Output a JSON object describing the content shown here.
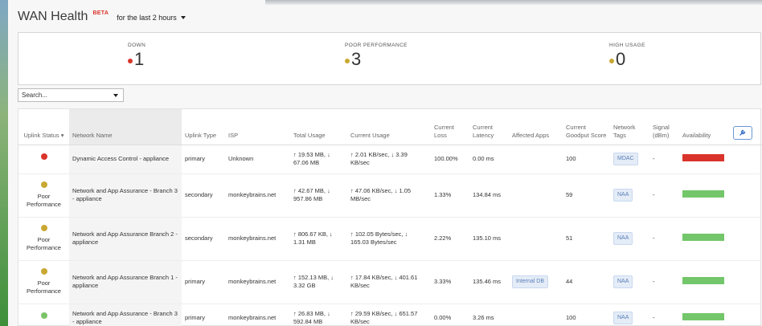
{
  "header": {
    "title": "WAN Health",
    "beta": "BETA",
    "timerange": "for the last 2 hours"
  },
  "summary": {
    "down": {
      "label": "DOWN",
      "value": "1",
      "color": "#d9342b"
    },
    "poor": {
      "label": "POOR PERFORMANCE",
      "value": "3",
      "color": "#c9a833"
    },
    "high": {
      "label": "HIGH USAGE",
      "value": "0",
      "color": "#c9a833"
    }
  },
  "search": {
    "placeholder": "Search..."
  },
  "columns": {
    "uplink_status": "Uplink Status ▾",
    "network_name": "Network Name",
    "uplink_type": "Uplink Type",
    "isp": "ISP",
    "total_usage": "Total Usage",
    "current_usage": "Current Usage",
    "current_loss": "Current Loss",
    "current_latency": "Current Latency",
    "affected_apps": "Affected Apps",
    "goodput": "Current Goodput Score",
    "tags": "Network Tags",
    "signal": "Signal (dBm)",
    "availability": "Availability"
  },
  "colors": {
    "red": "#d9342b",
    "yellow": "#c9a833",
    "green": "#7cc36a",
    "bar_green": "#73c66a"
  },
  "rows": [
    {
      "status_color": "red",
      "status_text": "",
      "network": "Dynamic Access Control - appliance",
      "type": "primary",
      "isp": "Unknown",
      "total": "↑ 19.53 MB, ↓ 67.06 MB",
      "current": "↑ 2.01 KB/sec, ↓ 3.39 KB/sec",
      "loss": "100.00%",
      "latency": "0.00 ms",
      "apps": "",
      "goodput": "100",
      "tag": "MDAC",
      "signal": "-",
      "availability": "red"
    },
    {
      "status_color": "yellow",
      "status_text": "Poor Performance",
      "network": "Network and App Assurance - Branch 3 - appliance",
      "type": "secondary",
      "isp": "monkeybrains.net",
      "total": "↑ 42.67 MB, ↓ 957.86 MB",
      "current": "↑ 47.06 KB/sec, ↓ 1.05 MB/sec",
      "loss": "1.33%",
      "latency": "134.84 ms",
      "apps": "",
      "goodput": "59",
      "tag": "NAA",
      "signal": "-",
      "availability": "green"
    },
    {
      "status_color": "yellow",
      "status_text": "Poor Performance",
      "network": "Network and App Assurance Branch 2 - appliance",
      "type": "secondary",
      "isp": "monkeybrains.net",
      "total": "↑ 806.67 KB, ↓ 1.31 MB",
      "current": "↑ 102.05 Bytes/sec, ↓ 165.03 Bytes/sec",
      "loss": "2.22%",
      "latency": "135.10 ms",
      "apps": "",
      "goodput": "51",
      "tag": "NAA",
      "signal": "-",
      "availability": "green"
    },
    {
      "status_color": "yellow",
      "status_text": "Poor Performance",
      "network": "Network and App Assurance Branch 1 - appliance",
      "type": "primary",
      "isp": "monkeybrains.net",
      "total": "↑ 152.13 MB, ↓ 3.32 GB",
      "current": "↑ 17.84 KB/sec, ↓ 401.61 KB/sec",
      "loss": "3.33%",
      "latency": "135.46 ms",
      "apps": "Internal DB",
      "goodput": "44",
      "tag": "NAA",
      "signal": "-",
      "availability": "green"
    },
    {
      "status_color": "green",
      "status_text": "",
      "network": "Network and App Assurance - Branch 3 - appliance",
      "type": "primary",
      "isp": "monkeybrains.net",
      "total": "↑ 26.83 MB, ↓ 592.84 MB",
      "current": "↑ 29.59 KB/sec, ↓ 651.57 KB/sec",
      "loss": "0.00%",
      "latency": "3.26 ms",
      "apps": "",
      "goodput": "100",
      "tag": "NAA",
      "signal": "-",
      "availability": "green"
    }
  ]
}
